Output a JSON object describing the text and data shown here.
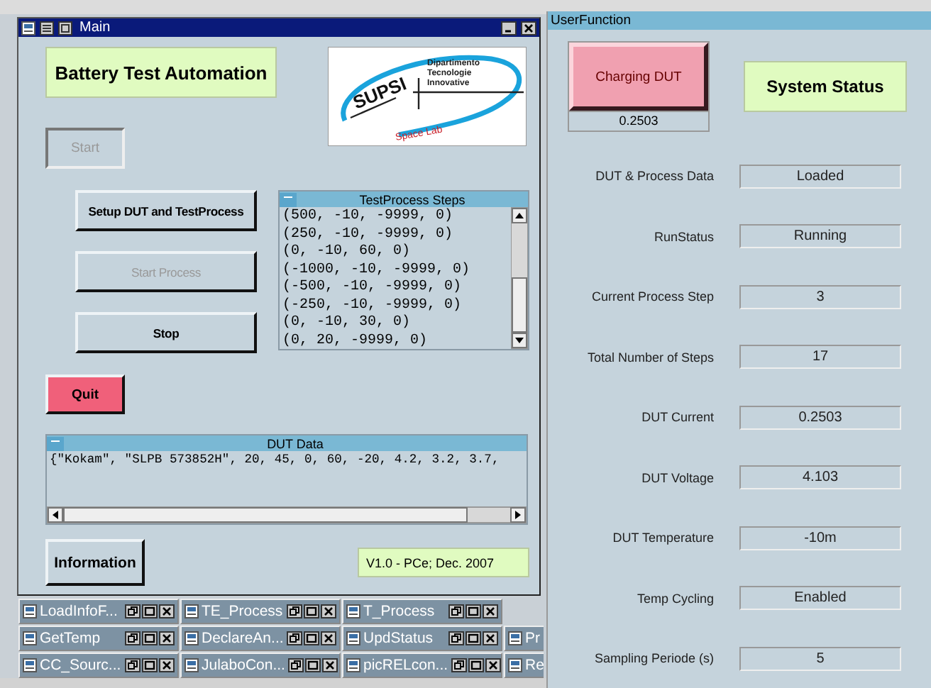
{
  "main_window": {
    "title": "Main",
    "header": "Battery Test Automation",
    "logo": {
      "wordmark": "SUPSI",
      "lines": [
        "Dipartimento",
        "Tecnologie",
        "Innovative"
      ],
      "tagline": "Space Lab"
    },
    "start_button": {
      "label": "Start",
      "disabled": true
    },
    "buttons": [
      {
        "label": "Setup DUT and TestProcess",
        "disabled": false
      },
      {
        "label": "Start Process",
        "disabled": true
      },
      {
        "label": "Stop",
        "disabled": false
      }
    ],
    "steps_list": {
      "title": "TestProcess Steps",
      "items": [
        "(500, -10, -9999, 0)",
        "(250, -10, -9999, 0)",
        "(0, -10, 60, 0)",
        "(-1000, -10, -9999, 0)",
        "(-500, -10, -9999, 0)",
        "(-250, -10, -9999, 0)",
        "(0, -10, 30, 0)",
        "(0, 20, -9999, 0)"
      ]
    },
    "quit_button": "Quit",
    "dut_data": {
      "title": "DUT Data",
      "text": "{\"Kokam\", \"SLPB 573852H\", 20, 45, 0, 60, -20, 4.2, 3.2, 3.7,"
    },
    "info_button": "Information",
    "version": "V1.0 - PCe; Dec. 2007"
  },
  "minimized_windows": [
    [
      {
        "title": "LoadInfoF...",
        "partial": false
      },
      {
        "title": "TE_Process",
        "partial": false
      },
      {
        "title": "T_Process",
        "partial": false
      }
    ],
    [
      {
        "title": "GetTemp",
        "partial": false
      },
      {
        "title": "DeclareAn...",
        "partial": false
      },
      {
        "title": "UpdStatus",
        "partial": false
      },
      {
        "title": "Pr",
        "partial": true
      }
    ],
    [
      {
        "title": "CC_Sourc...",
        "partial": false
      },
      {
        "title": "JulaboCon...",
        "partial": false
      },
      {
        "title": "picRELcon...",
        "partial": false
      },
      {
        "title": "Re",
        "partial": true
      }
    ]
  ],
  "user_function_window": {
    "title": "UserFunction",
    "charging": {
      "label": "Charging DUT",
      "value": "0.2503"
    },
    "header": "System Status",
    "status_rows": [
      {
        "label": "DUT & Process Data",
        "value": "Loaded"
      },
      {
        "label": "RunStatus",
        "value": "Running"
      },
      {
        "label": "Current Process Step",
        "value": "3"
      },
      {
        "label": "Total Number of Steps",
        "value": "17"
      },
      {
        "label": "DUT Current",
        "value": "0.2503"
      },
      {
        "label": "DUT Voltage",
        "value": "4.103"
      },
      {
        "label": "DUT Temperature",
        "value": "-10m"
      },
      {
        "label": "Temp Cycling",
        "value": "Enabled"
      },
      {
        "label": "Sampling Periode (s)",
        "value": "5"
      }
    ]
  }
}
